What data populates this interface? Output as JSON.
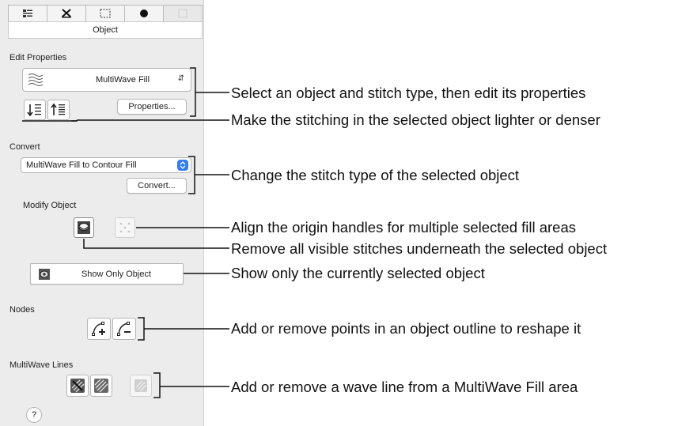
{
  "panel": {
    "tabs": [
      {
        "icon": "list-icon"
      },
      {
        "icon": "scissors-icon"
      },
      {
        "icon": "select-rect-icon"
      },
      {
        "icon": "sphere-icon"
      },
      {
        "icon": "blank-tab-icon"
      }
    ],
    "title": "Object",
    "edit_properties": {
      "heading": "Edit Properties",
      "stitch_type": "MultiWave Fill",
      "properties_button": "Properties..."
    },
    "convert": {
      "heading": "Convert",
      "selected": "MultiWave Fill to Contour Fill",
      "convert_button": "Convert..."
    },
    "modify_object": {
      "heading": "Modify Object",
      "show_only_button": "Show Only Object"
    },
    "nodes": {
      "heading": "Nodes"
    },
    "multiwave_lines": {
      "heading": "MultiWave Lines"
    },
    "help": "?"
  },
  "callouts": [
    "Select an object and stitch type, then edit its properties",
    "Make the stitching in the selected object lighter or denser",
    "Change the stitch type of the selected object",
    "Align the origin handles for multiple selected fill areas",
    "Remove all visible stitches underneath the selected object",
    "Show only the currently selected object",
    "Add or remove points in an object outline to reshape it",
    "Add or remove a wave line from a MultiWave Fill area"
  ],
  "colors": {
    "panel_bg": "#ececec",
    "accent": "#2f7cf6",
    "line": "#111111"
  }
}
